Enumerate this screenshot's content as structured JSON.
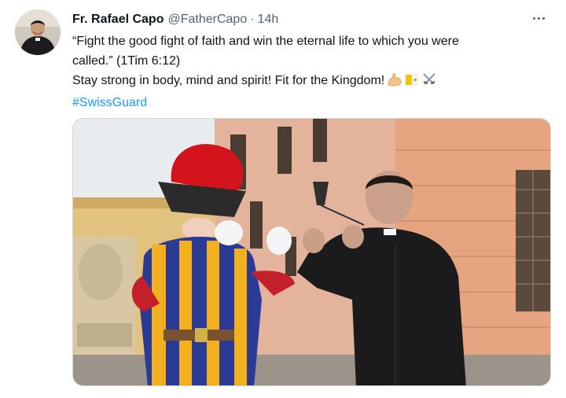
{
  "tweet": {
    "author": {
      "display_name": "Fr. Rafael Capo",
      "handle": "@FatherCapo",
      "avatar_icon": "profile-photo"
    },
    "separator": "·",
    "timestamp": "14h",
    "more_icon": "more-options-icon",
    "text": {
      "line1": "“Fight the good fight of faith and win the eternal life to which you were",
      "line2": "called.” (1Tim 6:12)",
      "line3": "Stay strong in body, mind and spirit! Fit for the Kingdom!",
      "emojis": [
        "flexed-biceps-icon",
        "vatican-flag-icon",
        "crossed-swords-icon"
      ],
      "hashtag": "#SwissGuard"
    },
    "media": {
      "type": "photo",
      "icon": "photo-two-men-sparring"
    }
  },
  "colors": {
    "accent": "#1d9bf0",
    "text_primary": "#0f1419",
    "text_secondary": "#536471"
  }
}
